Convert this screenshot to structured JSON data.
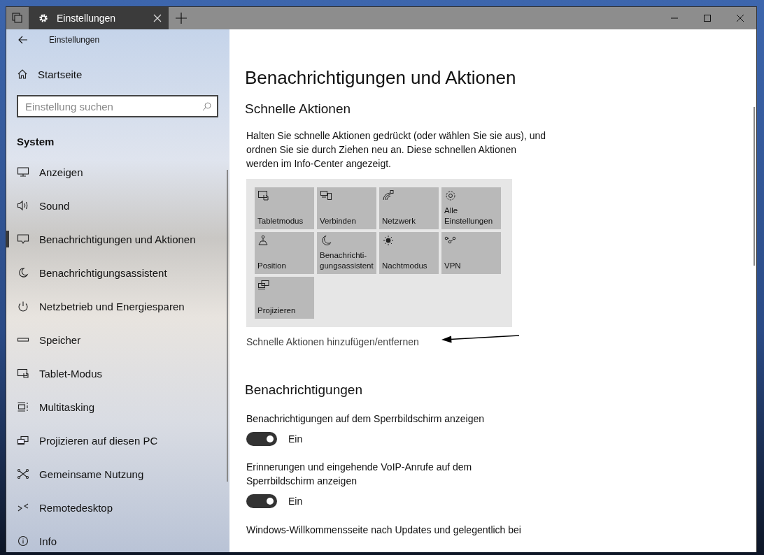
{
  "window": {
    "tab_title": "Einstellungen"
  },
  "sidebar": {
    "header": "Einstellungen",
    "home": "Startseite",
    "search": {
      "placeholder": "Einstellung suchen"
    },
    "section": "System",
    "items": [
      {
        "label": "Anzeigen",
        "selected": false
      },
      {
        "label": "Sound",
        "selected": false
      },
      {
        "label": "Benachrichtigungen und Aktionen",
        "selected": true
      },
      {
        "label": "Benachrichtigungsassistent",
        "selected": false
      },
      {
        "label": "Netzbetrieb und Energiesparen",
        "selected": false
      },
      {
        "label": "Speicher",
        "selected": false
      },
      {
        "label": "Tablet-Modus",
        "selected": false
      },
      {
        "label": "Multitasking",
        "selected": false
      },
      {
        "label": "Projizieren auf diesen PC",
        "selected": false
      },
      {
        "label": "Gemeinsame Nutzung",
        "selected": false
      },
      {
        "label": "Remotedesktop",
        "selected": false
      },
      {
        "label": "Info",
        "selected": false
      }
    ]
  },
  "content": {
    "title": "Benachrichtigungen und Aktionen",
    "quick_heading": "Schnelle Aktionen",
    "quick_text": "Halten Sie schnelle Aktionen gedrückt (oder wählen Sie sie aus), und ordnen Sie sie durch Ziehen neu an. Diese schnellen Aktionen werden im Info-Center angezeigt.",
    "quick_actions": [
      {
        "label": "Tabletmodus"
      },
      {
        "label": "Verbinden"
      },
      {
        "label": "Netzwerk"
      },
      {
        "label": "Alle Einstellungen"
      },
      {
        "label": "Position"
      },
      {
        "label": "Benachrichti-\ngungsassistent"
      },
      {
        "label": "Nachtmodus"
      },
      {
        "label": "VPN"
      },
      {
        "label": "Projizieren"
      }
    ],
    "quick_link": "Schnelle Aktionen hinzufügen/entfernen",
    "notif_heading": "Benachrichtigungen",
    "settings": [
      {
        "label": "Benachrichtigungen auf dem Sperrbildschirm anzeigen",
        "on": true,
        "state": "Ein"
      },
      {
        "label": "Erinnerungen und eingehende VoIP-Anrufe auf dem Sperrbildschirm anzeigen",
        "on": true,
        "state": "Ein"
      }
    ],
    "more_text": "Windows-Willkommensseite nach Updates und gelegentlich bei"
  }
}
